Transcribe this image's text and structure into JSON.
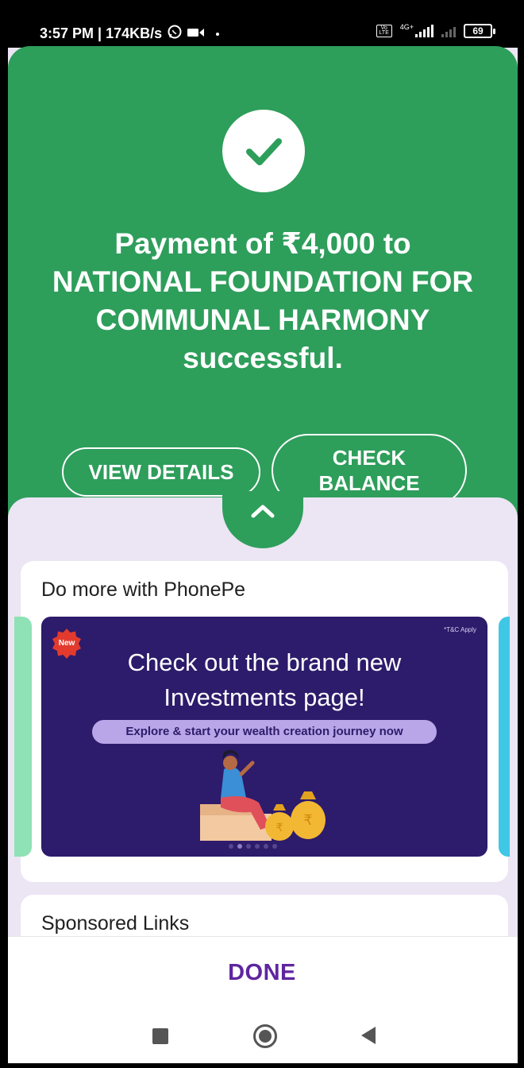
{
  "status_bar": {
    "time": "3:57 PM | 174KB/s",
    "network": "4G+",
    "volte": "VoLTE",
    "battery": "69"
  },
  "payment": {
    "message": "Payment of ₹4,000 to NATIONAL FOUNDATION FOR COMMUNAL HARMONY successful.",
    "view_details_label": "VIEW DETAILS",
    "check_balance_label": "CHECK BALANCE"
  },
  "do_more": {
    "title": "Do more with PhonePe",
    "banner": {
      "badge": "New",
      "terms": "*T&C Apply",
      "headline": "Check out the brand new Investments page!",
      "cta": "Explore & start your wealth creation journey now"
    }
  },
  "sponsored": {
    "title": "Sponsored Links"
  },
  "footer": {
    "done_label": "DONE"
  },
  "colors": {
    "success_green": "#2e9e5b",
    "brand_purple": "#5f259f",
    "banner_bg": "#2d1b6b",
    "sheet_bg": "#ece5f4"
  },
  "icons": [
    "success-check-icon",
    "chevron-up-icon",
    "whatsapp-icon",
    "video-icon",
    "nav-recents-icon",
    "nav-home-icon",
    "nav-back-icon"
  ]
}
